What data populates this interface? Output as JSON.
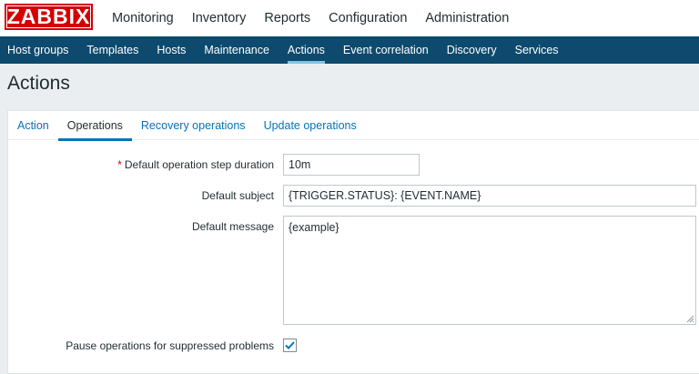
{
  "logo": {
    "text": "ZABBIX"
  },
  "top_menu": {
    "items": [
      {
        "label": "Monitoring"
      },
      {
        "label": "Inventory"
      },
      {
        "label": "Reports"
      },
      {
        "label": "Configuration"
      },
      {
        "label": "Administration"
      }
    ],
    "active": "Configuration"
  },
  "sub_menu": {
    "items": [
      {
        "label": "Host groups"
      },
      {
        "label": "Templates"
      },
      {
        "label": "Hosts"
      },
      {
        "label": "Maintenance"
      },
      {
        "label": "Actions"
      },
      {
        "label": "Event correlation"
      },
      {
        "label": "Discovery"
      },
      {
        "label": "Services"
      }
    ],
    "active": "Actions"
  },
  "page": {
    "title": "Actions"
  },
  "tabs": {
    "items": [
      {
        "label": "Action"
      },
      {
        "label": "Operations"
      },
      {
        "label": "Recovery operations"
      },
      {
        "label": "Update operations"
      }
    ],
    "active": "Operations"
  },
  "form": {
    "step_duration": {
      "required_mark": "*",
      "label": "Default operation step duration",
      "value": "10m"
    },
    "subject": {
      "label": "Default subject",
      "value": "{TRIGGER.STATUS}: {EVENT.NAME}"
    },
    "message": {
      "label": "Default message",
      "value": "{example}"
    },
    "pause": {
      "label": "Pause operations for suppressed problems",
      "checked": true
    }
  },
  "colors": {
    "brand_red": "#d40000",
    "subnav_bg": "#0d4a6e",
    "link_blue": "#0275b8",
    "page_bg": "#ebeef0"
  }
}
